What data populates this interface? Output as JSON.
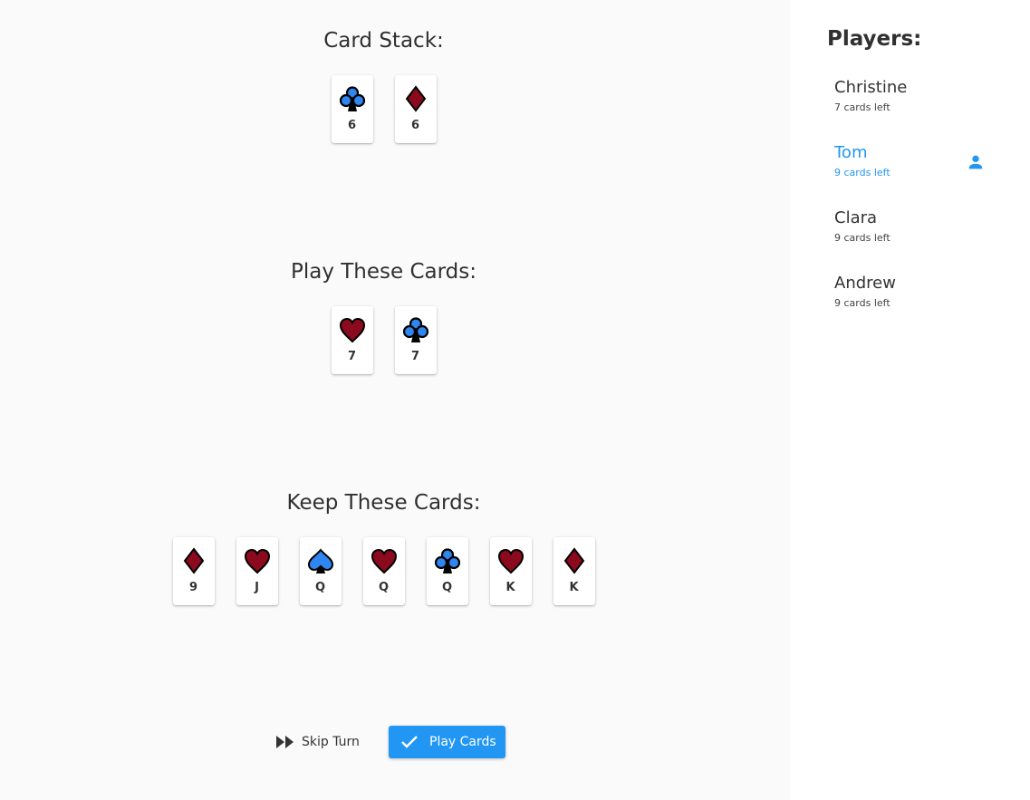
{
  "sections": {
    "stack_title": "Card Stack:",
    "play_title": "Play These Cards:",
    "keep_title": "Keep These Cards:"
  },
  "stack_cards": [
    {
      "suit": "clubs",
      "rank": "6"
    },
    {
      "suit": "diamonds",
      "rank": "6"
    }
  ],
  "play_cards": [
    {
      "suit": "hearts",
      "rank": "7"
    },
    {
      "suit": "clubs",
      "rank": "7"
    }
  ],
  "keep_cards": [
    {
      "suit": "diamonds",
      "rank": "9"
    },
    {
      "suit": "hearts",
      "rank": "J"
    },
    {
      "suit": "spades",
      "rank": "Q"
    },
    {
      "suit": "hearts",
      "rank": "Q"
    },
    {
      "suit": "clubs",
      "rank": "Q"
    },
    {
      "suit": "hearts",
      "rank": "K"
    },
    {
      "suit": "diamonds",
      "rank": "K"
    }
  ],
  "actions": {
    "skip_label": "Skip Turn",
    "play_label": "Play Cards"
  },
  "players_title": "Players:",
  "players": [
    {
      "name": "Christine",
      "cards": "7 cards left",
      "active": false
    },
    {
      "name": "Tom",
      "cards": "9 cards left",
      "active": true
    },
    {
      "name": "Clara",
      "cards": "9 cards left",
      "active": false
    },
    {
      "name": "Andrew",
      "cards": "9 cards left",
      "active": false
    }
  ],
  "colors": {
    "red_suit": "#8b0a1e",
    "blue_suit": "#2f86f0",
    "accent": "#2196f3"
  },
  "icons": {
    "skip": "fast-forward-icon",
    "play": "check-icon",
    "current_player": "person-icon"
  }
}
